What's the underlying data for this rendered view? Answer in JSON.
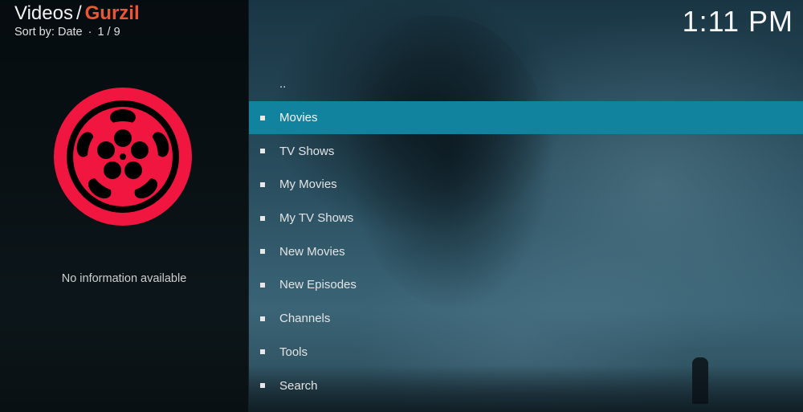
{
  "header": {
    "section": "Videos",
    "separator": "/",
    "current": "Gurzil",
    "sort_label": "Sort by: Date",
    "dot": "·",
    "page_info": "1 / 9"
  },
  "clock": "1:11 PM",
  "info_panel": {
    "icon": "film-reel-icon",
    "message": "No information available"
  },
  "list": {
    "updir": "..",
    "items": [
      {
        "label": "Movies",
        "selected": true
      },
      {
        "label": "TV Shows"
      },
      {
        "label": "My Movies"
      },
      {
        "label": "My TV Shows"
      },
      {
        "label": "New Movies"
      },
      {
        "label": "New Episodes"
      },
      {
        "label": "Channels"
      },
      {
        "label": "Tools"
      },
      {
        "label": "Search"
      }
    ]
  },
  "colors": {
    "accent": "#ee5533",
    "selection": "#12839f",
    "reel": "#f0163f"
  }
}
